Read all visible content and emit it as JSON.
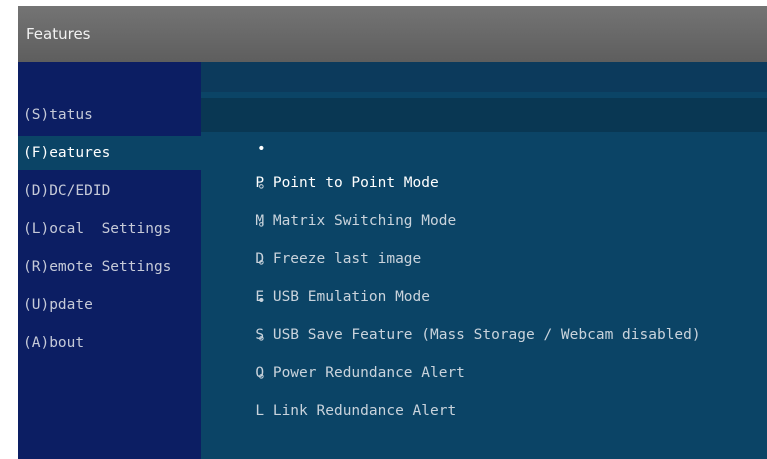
{
  "window": {
    "title": "Features"
  },
  "sidebar": {
    "items": [
      {
        "label": "(S)tatus"
      },
      {
        "label": "(F)eatures",
        "active": true
      },
      {
        "label": "(D)DC/EDID"
      },
      {
        "label": "(L)ocal  Settings"
      },
      {
        "label": "(R)emote Settings"
      },
      {
        "label": "(U)pdate"
      },
      {
        "label": "(A)bout"
      }
    ]
  },
  "features": {
    "items": [
      {
        "marker": "•",
        "label": "P Point to Point Mode",
        "selected": true
      },
      {
        "marker": "∘",
        "label": "M Matrix Switching Mode",
        "selected": false
      },
      {
        "marker": "∘",
        "label": "D Freeze last image",
        "selected": false
      },
      {
        "marker": "∘",
        "label": "E USB Emulation Mode",
        "selected": false
      },
      {
        "marker": "•",
        "label": "S USB Save Feature (Mass Storage / Webcam disabled)",
        "selected": true
      },
      {
        "marker": "∘",
        "label": "O Power Redundance Alert",
        "selected": false
      },
      {
        "marker": "∘",
        "label": "L Link Redundance Alert",
        "selected": false
      }
    ]
  },
  "colors": {
    "titlebar": "#6a6a6a",
    "sidebar": "#0c1e63",
    "content": "#0b4466",
    "highlight": "#093753"
  }
}
